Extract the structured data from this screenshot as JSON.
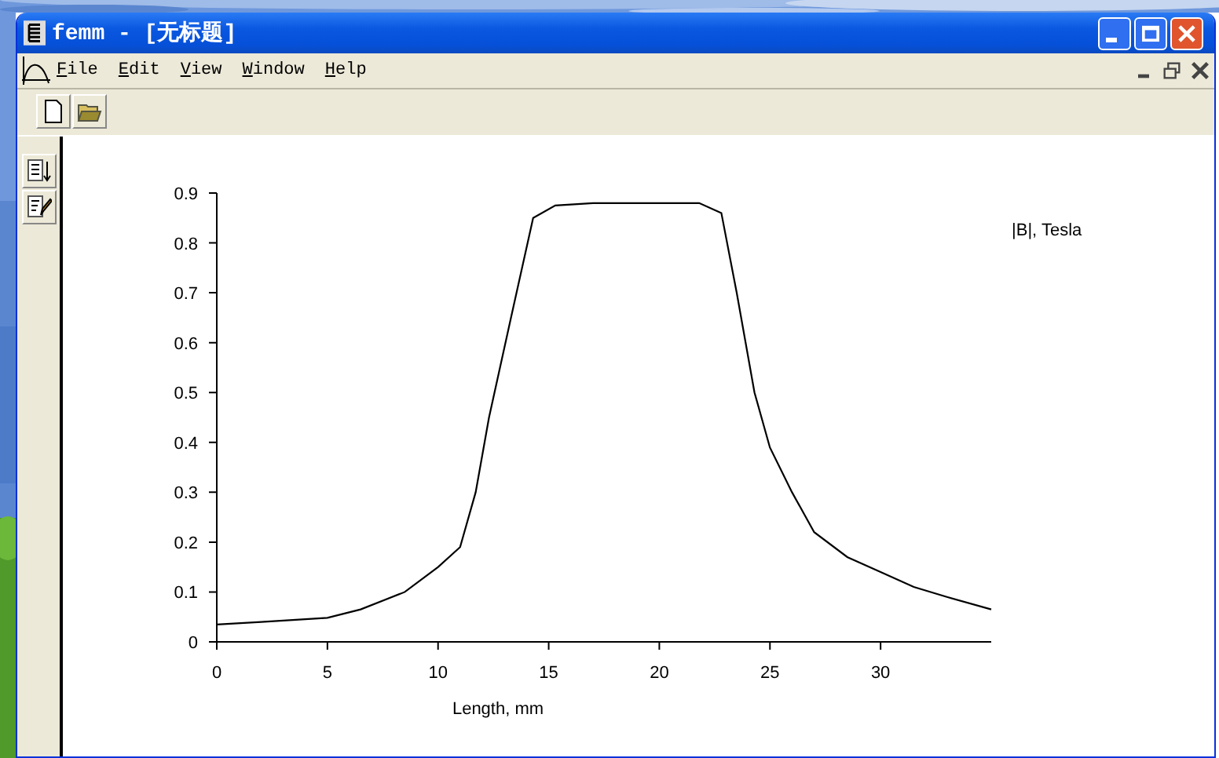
{
  "window": {
    "title": "femm - [无标题]"
  },
  "menu": {
    "items": [
      "File",
      "Edit",
      "View",
      "Window",
      "Help"
    ]
  },
  "chart_data": {
    "type": "line",
    "xlabel": "Length, mm",
    "xlim": [
      0,
      35
    ],
    "ylim": [
      0,
      0.9
    ],
    "xticks": [
      0,
      5,
      10,
      15,
      20,
      25,
      30
    ],
    "yticks": [
      0,
      0.1,
      0.2,
      0.3,
      0.4,
      0.5,
      0.6,
      0.7,
      0.8,
      0.9
    ],
    "x": [
      0,
      2,
      5,
      6.5,
      8.5,
      10,
      11,
      11.7,
      12.3,
      13.3,
      14.3,
      15.3,
      17,
      20,
      21.8,
      22.8,
      23.5,
      24.3,
      25,
      26,
      27,
      28.5,
      30,
      31.5,
      33,
      35
    ],
    "series": [
      {
        "name": "|B|, Tesla",
        "color": "#000000",
        "values": [
          0.035,
          0.04,
          0.048,
          0.065,
          0.1,
          0.15,
          0.19,
          0.3,
          0.45,
          0.65,
          0.85,
          0.875,
          0.88,
          0.88,
          0.88,
          0.86,
          0.7,
          0.5,
          0.39,
          0.3,
          0.22,
          0.17,
          0.14,
          0.11,
          0.09,
          0.065
        ]
      }
    ]
  }
}
